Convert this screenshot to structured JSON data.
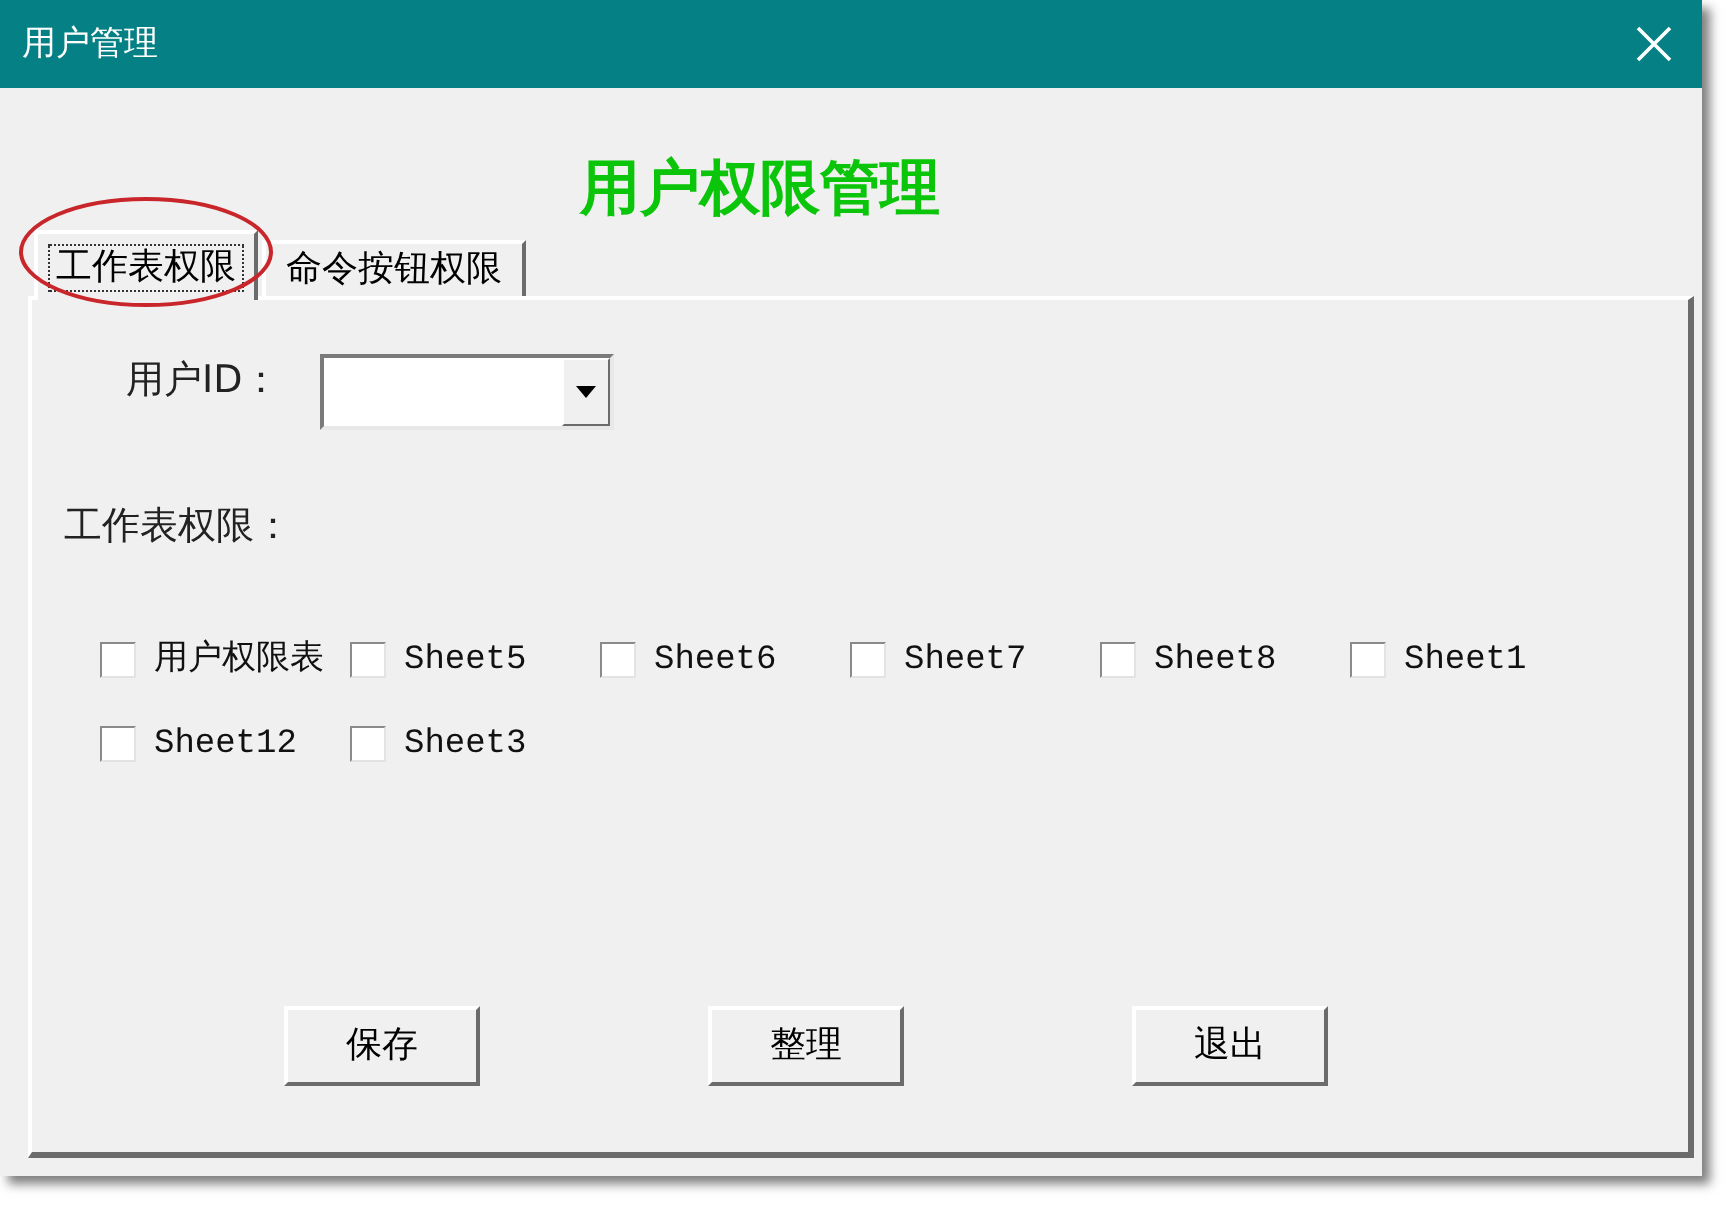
{
  "window": {
    "title": "用户管理"
  },
  "heading": "用户权限管理",
  "tabs": [
    {
      "label": "工作表权限",
      "selected": true,
      "circled": true
    },
    {
      "label": "命令按钮权限",
      "selected": false,
      "circled": false
    }
  ],
  "user_id": {
    "label": "用户ID："
  },
  "sheet_permissions": {
    "label": "工作表权限：",
    "checkboxes": [
      {
        "label": "用户权限表",
        "checked": false
      },
      {
        "label": "Sheet5",
        "checked": false
      },
      {
        "label": "Sheet6",
        "checked": false
      },
      {
        "label": "Sheet7",
        "checked": false
      },
      {
        "label": "Sheet8",
        "checked": false
      },
      {
        "label": "Sheet1",
        "checked": false
      },
      {
        "label": "Sheet12",
        "checked": false
      },
      {
        "label": "Sheet3",
        "checked": false
      }
    ]
  },
  "buttons": [
    "保存",
    "整理",
    "退出"
  ]
}
